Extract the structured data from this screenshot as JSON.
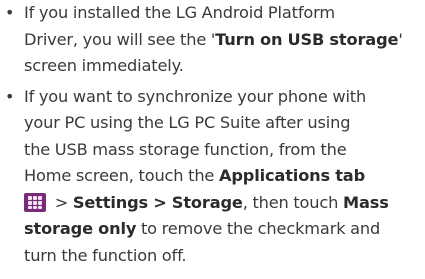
{
  "items": [
    {
      "bullet": "•",
      "lines": [
        [
          "If you installed the LG Android Platform"
        ],
        [
          "Driver, you will see the '",
          "Turn on USB storage",
          "'"
        ],
        [
          "screen immediately."
        ]
      ]
    },
    {
      "bullet": "•",
      "lines": [
        [
          "If you want to synchronize your phone with"
        ],
        [
          "your PC using the LG PC Suite after using"
        ],
        [
          "the USB mass storage function, from the"
        ],
        [
          "Home screen, touch the ",
          "Applications tab"
        ],
        [
          " > ",
          "Settings > Storage",
          ", then touch ",
          "Mass"
        ],
        [
          "storage only",
          " to remove the checkmark and"
        ],
        [
          "turn the function off."
        ]
      ]
    }
  ],
  "icons": {
    "apps_icon": "applications-grid-icon",
    "apps_icon_color": "#7a2a7a"
  }
}
